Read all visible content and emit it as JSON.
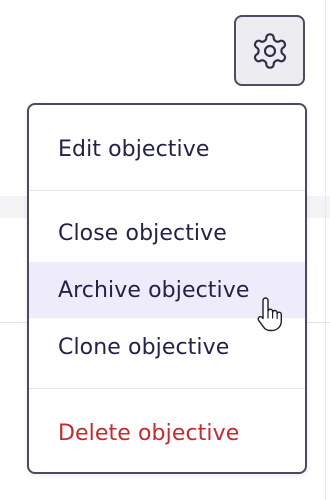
{
  "toolbar": {
    "settings_icon": "gear-icon"
  },
  "menu": {
    "items": [
      {
        "label": "Edit objective"
      },
      {
        "label": "Close objective"
      },
      {
        "label": "Archive objective"
      },
      {
        "label": "Clone objective"
      },
      {
        "label": "Delete objective"
      }
    ],
    "highlighted_item": "Archive objective"
  },
  "colors": {
    "text": "#23234a",
    "danger": "#c42a2f",
    "highlight": "#eeecfb",
    "border": "#4a4a62"
  },
  "cursor": "hand-pointer-icon"
}
